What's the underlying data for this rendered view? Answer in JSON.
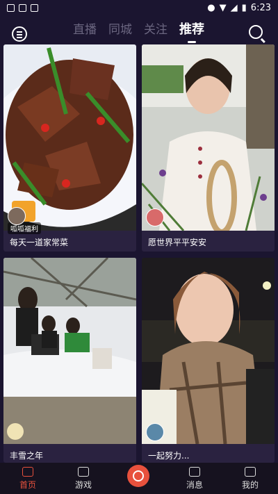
{
  "status_bar": {
    "time": "6:23"
  },
  "tabs": [
    {
      "label": "直播",
      "active": false
    },
    {
      "label": "同城",
      "active": false
    },
    {
      "label": "关注",
      "active": false
    },
    {
      "label": "推荐",
      "active": true
    }
  ],
  "cards": [
    {
      "caption": "每天一道家常菜",
      "badge": "呱呱福利"
    },
    {
      "caption": "愿世界平平安安"
    },
    {
      "caption": "丰雪之年"
    },
    {
      "caption": "一起努力..."
    }
  ],
  "bottom_nav": [
    {
      "label": "首页",
      "active": true
    },
    {
      "label": "游戏",
      "active": false
    },
    {
      "label": "消息",
      "active": false
    },
    {
      "label": "我的",
      "active": false
    }
  ],
  "colors": {
    "accent": "#e8513d",
    "background": "#1b1530"
  }
}
